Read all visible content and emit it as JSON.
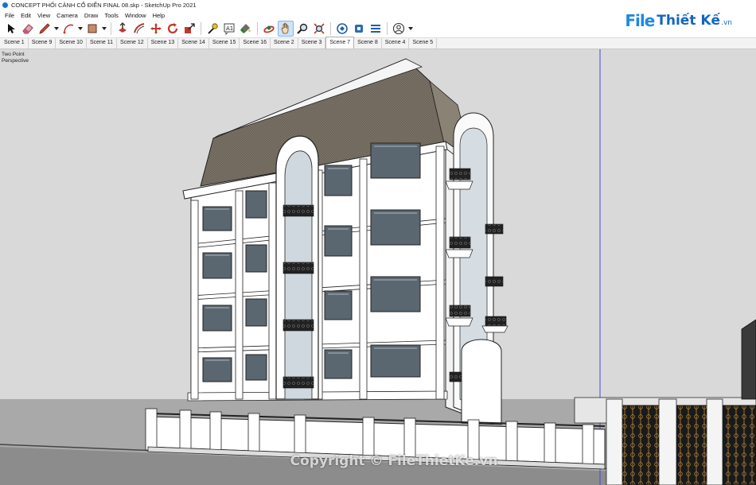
{
  "window": {
    "title": "CONCEPT PHỐI CẢNH CỔ ĐIỂN FINAL 08.skp - SketchUp Pro 2021"
  },
  "menu": [
    "File",
    "Edit",
    "View",
    "Camera",
    "Draw",
    "Tools",
    "Window",
    "Help"
  ],
  "logo": {
    "file": "File",
    "rest": "Thiết Kế",
    "tld": ".vn"
  },
  "toolbar": {
    "tools": [
      {
        "icon": "select-arrow-icon"
      },
      {
        "icon": "eraser-icon"
      },
      {
        "icon": "line-pencil-icon",
        "dropdown": true
      },
      {
        "icon": "arc-icon",
        "dropdown": true
      },
      {
        "icon": "rectangle-icon",
        "dropdown": true
      },
      {
        "icon": "push-pull-icon"
      },
      {
        "icon": "offset-icon"
      },
      {
        "icon": "move-icon"
      },
      {
        "icon": "rotate-icon"
      },
      {
        "icon": "scale-icon"
      },
      {
        "icon": "tape-measure-icon"
      },
      {
        "icon": "text-icon"
      },
      {
        "icon": "paint-bucket-icon"
      },
      {
        "icon": "orbit-icon"
      },
      {
        "icon": "pan-hand-icon",
        "active": true
      },
      {
        "icon": "zoom-icon"
      },
      {
        "icon": "zoom-extents-icon"
      },
      {
        "icon": "warehouse-icon"
      },
      {
        "icon": "extension-warehouse-icon"
      },
      {
        "icon": "layout-icon"
      },
      {
        "icon": "account-icon",
        "dropdown": true
      }
    ]
  },
  "scenes": {
    "tabs": [
      "Scene 1",
      "Scene 9",
      "Scene 10",
      "Scene 11",
      "Scene 12",
      "Scene 13",
      "Scene 14",
      "Scene 15",
      "Scene 16",
      "Scene 2",
      "Scene 3",
      "Scene 7",
      "Scene 8",
      "Scene 4",
      "Scene 5"
    ],
    "active": "Scene 7"
  },
  "viewport": {
    "camera_label": "Two Point Perspective",
    "watermark": "Copyright © FileThietKe.vn",
    "sky_color": "#d9d9d9",
    "ground_color": "#a9a9a9",
    "roof_color": "#7a7266",
    "wall_color": "#ffffff",
    "axis_blue": "#3f4fd6"
  }
}
